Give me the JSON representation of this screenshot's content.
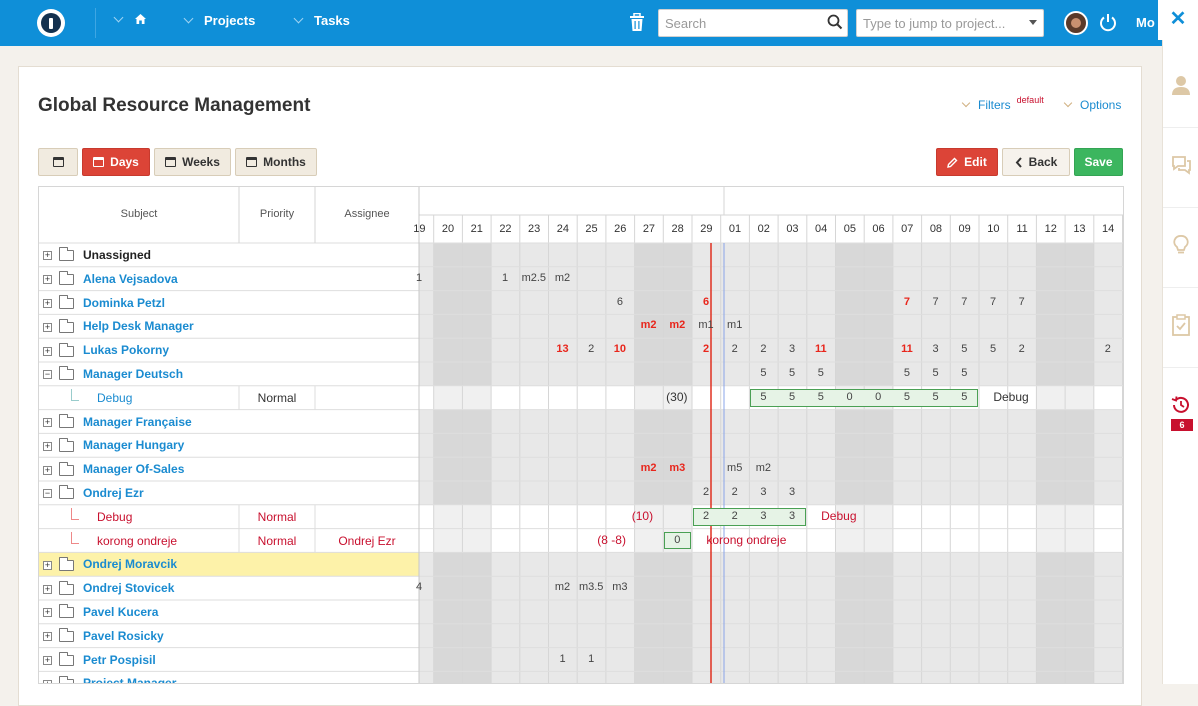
{
  "topbar": {
    "projects_label": "Projects",
    "tasks_label": "Tasks",
    "search_placeholder": "Search",
    "jump_placeholder": "Type to jump to project...",
    "more_label": "Mo"
  },
  "page": {
    "title": "Global Resource Management",
    "filters_label": "Filters",
    "filters_badge": "default",
    "options_label": "Options"
  },
  "toolbar": {
    "days_label": "Days",
    "weeks_label": "Weeks",
    "months_label": "Months",
    "edit_label": "Edit",
    "back_label": "Back",
    "save_label": "Save"
  },
  "columns": {
    "subject": "Subject",
    "priority": "Priority",
    "assignee": "Assignee"
  },
  "days": [
    "19",
    "20",
    "21",
    "22",
    "23",
    "24",
    "25",
    "26",
    "27",
    "28",
    "29",
    "01",
    "02",
    "03",
    "04",
    "05",
    "06",
    "07",
    "08",
    "09",
    "10",
    "11",
    "12",
    "13",
    "14"
  ],
  "rows": [
    {
      "name": "Unassigned",
      "type": "group",
      "style": "dark"
    },
    {
      "name": "Alena Vejsadova",
      "type": "group"
    },
    {
      "name": "Dominka Petzl",
      "type": "group"
    },
    {
      "name": "Help Desk Manager",
      "type": "group"
    },
    {
      "name": "Lukas Pokorny",
      "type": "group"
    },
    {
      "name": "Manager Deutsch",
      "type": "group",
      "expanded": true
    },
    {
      "name": "Debug",
      "type": "task",
      "priority": "Normal",
      "assignee": "",
      "style": "blue"
    },
    {
      "name": "Manager Française",
      "type": "group"
    },
    {
      "name": "Manager Hungary",
      "type": "group"
    },
    {
      "name": "Manager Of-Sales",
      "type": "group"
    },
    {
      "name": "Ondrej Ezr",
      "type": "group",
      "expanded": true
    },
    {
      "name": "Debug",
      "type": "task",
      "priority": "Normal",
      "assignee": "",
      "style": "red"
    },
    {
      "name": "korong ondreje",
      "type": "task",
      "priority": "Normal",
      "assignee": "Ondrej Ezr",
      "style": "red"
    },
    {
      "name": "Ondrej Moravcik",
      "type": "group",
      "highlight": true
    },
    {
      "name": "Ondrej Stovicek",
      "type": "group"
    },
    {
      "name": "Pavel Kucera",
      "type": "group"
    },
    {
      "name": "Pavel Rosicky",
      "type": "group"
    },
    {
      "name": "Petr Pospisil",
      "type": "group"
    },
    {
      "name": "Project Manager",
      "type": "group"
    }
  ],
  "grid_values": [
    {
      "row": 1,
      "cells": [
        [
          "1",
          0
        ],
        [
          "1",
          3
        ],
        [
          "m2.5",
          4
        ],
        [
          "m2",
          5
        ]
      ]
    },
    {
      "row": 2,
      "cells": [
        [
          "6",
          7
        ],
        [
          "6",
          10,
          "red"
        ],
        [
          "7",
          17,
          "red"
        ],
        [
          "7",
          18
        ],
        [
          "7",
          19
        ],
        [
          "7",
          20
        ],
        [
          "7",
          21
        ]
      ]
    },
    {
      "row": 3,
      "cells": [
        [
          "m2",
          8,
          "red"
        ],
        [
          "m2",
          9,
          "red"
        ],
        [
          "m1",
          10
        ],
        [
          "m1",
          11
        ]
      ]
    },
    {
      "row": 4,
      "cells": [
        [
          "13",
          5,
          "red"
        ],
        [
          "2",
          6
        ],
        [
          "10",
          7,
          "red"
        ],
        [
          "2",
          10,
          "red"
        ],
        [
          "2",
          11
        ],
        [
          "2",
          12
        ],
        [
          "3",
          13
        ],
        [
          "11",
          14,
          "red"
        ],
        [
          "11",
          17,
          "red"
        ],
        [
          "3",
          18
        ],
        [
          "5",
          19
        ],
        [
          "5",
          20
        ],
        [
          "2",
          21
        ],
        [
          "2",
          24
        ]
      ]
    },
    {
      "row": 5,
      "cells": [
        [
          "5",
          12
        ],
        [
          "5",
          13
        ],
        [
          "5",
          14
        ],
        [
          "5",
          17
        ],
        [
          "5",
          18
        ],
        [
          "5",
          19
        ]
      ]
    },
    {
      "row": 6,
      "cells": [
        [
          "5",
          12
        ],
        [
          "5",
          13
        ],
        [
          "5",
          14
        ],
        [
          "0",
          15
        ],
        [
          "0",
          16
        ],
        [
          "5",
          17
        ],
        [
          "5",
          18
        ],
        [
          "5",
          19
        ]
      ]
    },
    {
      "row": 9,
      "cells": [
        [
          "m2",
          8,
          "red"
        ],
        [
          "m3",
          9,
          "red"
        ],
        [
          "m5",
          11
        ],
        [
          "m2",
          12
        ]
      ]
    },
    {
      "row": 10,
      "cells": [
        [
          "2",
          10
        ],
        [
          "2",
          11
        ],
        [
          "3",
          12
        ],
        [
          "3",
          13
        ]
      ]
    },
    {
      "row": 11,
      "cells": [
        [
          "2",
          10
        ],
        [
          "2",
          11
        ],
        [
          "3",
          12
        ],
        [
          "3",
          13
        ]
      ]
    },
    {
      "row": 12,
      "cells": [
        [
          "0",
          9
        ]
      ]
    },
    {
      "row": 14,
      "cells": [
        [
          "4",
          0
        ],
        [
          "m2",
          5
        ],
        [
          "m3.5",
          6
        ],
        [
          "m3",
          7
        ]
      ]
    },
    {
      "row": 17,
      "cells": [
        [
          "1",
          5
        ],
        [
          "1",
          6
        ]
      ]
    }
  ],
  "bar_labels": [
    {
      "row": 6,
      "before": "(30)",
      "after": "Debug",
      "color": "#333"
    },
    {
      "row": 11,
      "before": "(10)",
      "after": "Debug",
      "color": "#c8102e"
    },
    {
      "row": 12,
      "before": "(8 -8)",
      "after": "korong ondreje",
      "color": "#c8102e"
    }
  ],
  "sidebar_badge": "6"
}
